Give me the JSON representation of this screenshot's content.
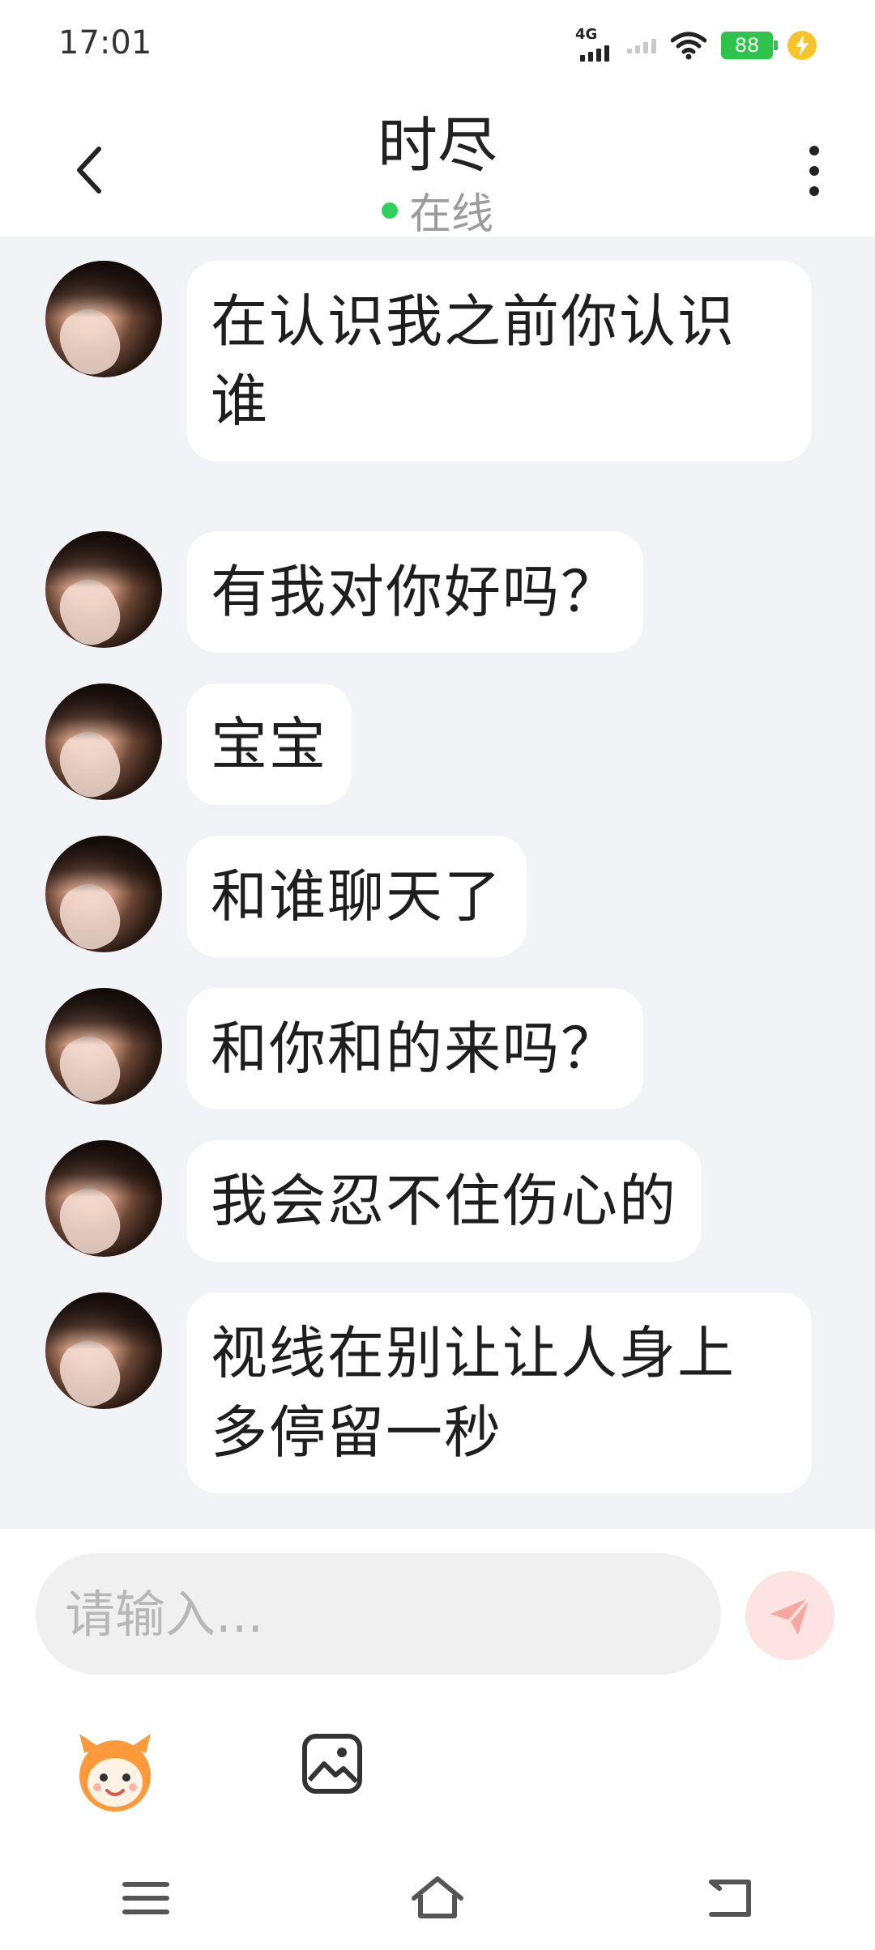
{
  "status_bar": {
    "time": "17:01",
    "network": "4G",
    "battery": "88"
  },
  "header": {
    "title": "时尽",
    "status": "在线"
  },
  "messages": [
    {
      "text": "在认识我之前你认识谁"
    },
    {
      "text": "有我对你好吗？"
    },
    {
      "text": "宝宝"
    },
    {
      "text": "和谁聊天了"
    },
    {
      "text": "和你和的来吗？"
    },
    {
      "text": "我会忍不住伤心的"
    },
    {
      "text": "视线在别让让人身上多停留一秒"
    }
  ],
  "composer": {
    "placeholder": "请输入...",
    "value": ""
  },
  "icons": {
    "back": "back-arrow-icon",
    "more": "more-vertical-icon",
    "send": "send-icon",
    "emoji": "emoji-mascot-icon",
    "image": "image-icon",
    "nav_menu": "menu-icon",
    "nav_home": "home-icon",
    "nav_back": "back-icon"
  },
  "colors": {
    "online": "#2fd05b",
    "chat_bg": "#f1f3f7",
    "send_accent": "#f6988f",
    "battery": "#2ec34a"
  }
}
